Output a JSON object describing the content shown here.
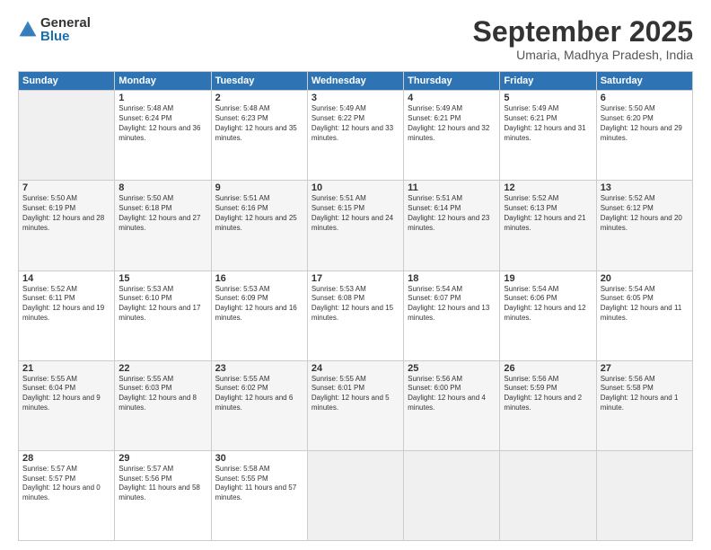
{
  "logo": {
    "general": "General",
    "blue": "Blue"
  },
  "title": "September 2025",
  "subtitle": "Umaria, Madhya Pradesh, India",
  "weekdays": [
    "Sunday",
    "Monday",
    "Tuesday",
    "Wednesday",
    "Thursday",
    "Friday",
    "Saturday"
  ],
  "weeks": [
    [
      {
        "day": "",
        "empty": true
      },
      {
        "day": "1",
        "sunrise": "5:48 AM",
        "sunset": "6:24 PM",
        "daylight": "12 hours and 36 minutes."
      },
      {
        "day": "2",
        "sunrise": "5:48 AM",
        "sunset": "6:23 PM",
        "daylight": "12 hours and 35 minutes."
      },
      {
        "day": "3",
        "sunrise": "5:49 AM",
        "sunset": "6:22 PM",
        "daylight": "12 hours and 33 minutes."
      },
      {
        "day": "4",
        "sunrise": "5:49 AM",
        "sunset": "6:21 PM",
        "daylight": "12 hours and 32 minutes."
      },
      {
        "day": "5",
        "sunrise": "5:49 AM",
        "sunset": "6:21 PM",
        "daylight": "12 hours and 31 minutes."
      },
      {
        "day": "6",
        "sunrise": "5:50 AM",
        "sunset": "6:20 PM",
        "daylight": "12 hours and 29 minutes."
      }
    ],
    [
      {
        "day": "7",
        "sunrise": "5:50 AM",
        "sunset": "6:19 PM",
        "daylight": "12 hours and 28 minutes."
      },
      {
        "day": "8",
        "sunrise": "5:50 AM",
        "sunset": "6:18 PM",
        "daylight": "12 hours and 27 minutes."
      },
      {
        "day": "9",
        "sunrise": "5:51 AM",
        "sunset": "6:16 PM",
        "daylight": "12 hours and 25 minutes."
      },
      {
        "day": "10",
        "sunrise": "5:51 AM",
        "sunset": "6:15 PM",
        "daylight": "12 hours and 24 minutes."
      },
      {
        "day": "11",
        "sunrise": "5:51 AM",
        "sunset": "6:14 PM",
        "daylight": "12 hours and 23 minutes."
      },
      {
        "day": "12",
        "sunrise": "5:52 AM",
        "sunset": "6:13 PM",
        "daylight": "12 hours and 21 minutes."
      },
      {
        "day": "13",
        "sunrise": "5:52 AM",
        "sunset": "6:12 PM",
        "daylight": "12 hours and 20 minutes."
      }
    ],
    [
      {
        "day": "14",
        "sunrise": "5:52 AM",
        "sunset": "6:11 PM",
        "daylight": "12 hours and 19 minutes."
      },
      {
        "day": "15",
        "sunrise": "5:53 AM",
        "sunset": "6:10 PM",
        "daylight": "12 hours and 17 minutes."
      },
      {
        "day": "16",
        "sunrise": "5:53 AM",
        "sunset": "6:09 PM",
        "daylight": "12 hours and 16 minutes."
      },
      {
        "day": "17",
        "sunrise": "5:53 AM",
        "sunset": "6:08 PM",
        "daylight": "12 hours and 15 minutes."
      },
      {
        "day": "18",
        "sunrise": "5:54 AM",
        "sunset": "6:07 PM",
        "daylight": "12 hours and 13 minutes."
      },
      {
        "day": "19",
        "sunrise": "5:54 AM",
        "sunset": "6:06 PM",
        "daylight": "12 hours and 12 minutes."
      },
      {
        "day": "20",
        "sunrise": "5:54 AM",
        "sunset": "6:05 PM",
        "daylight": "12 hours and 11 minutes."
      }
    ],
    [
      {
        "day": "21",
        "sunrise": "5:55 AM",
        "sunset": "6:04 PM",
        "daylight": "12 hours and 9 minutes."
      },
      {
        "day": "22",
        "sunrise": "5:55 AM",
        "sunset": "6:03 PM",
        "daylight": "12 hours and 8 minutes."
      },
      {
        "day": "23",
        "sunrise": "5:55 AM",
        "sunset": "6:02 PM",
        "daylight": "12 hours and 6 minutes."
      },
      {
        "day": "24",
        "sunrise": "5:55 AM",
        "sunset": "6:01 PM",
        "daylight": "12 hours and 5 minutes."
      },
      {
        "day": "25",
        "sunrise": "5:56 AM",
        "sunset": "6:00 PM",
        "daylight": "12 hours and 4 minutes."
      },
      {
        "day": "26",
        "sunrise": "5:56 AM",
        "sunset": "5:59 PM",
        "daylight": "12 hours and 2 minutes."
      },
      {
        "day": "27",
        "sunrise": "5:56 AM",
        "sunset": "5:58 PM",
        "daylight": "12 hours and 1 minute."
      }
    ],
    [
      {
        "day": "28",
        "sunrise": "5:57 AM",
        "sunset": "5:57 PM",
        "daylight": "12 hours and 0 minutes."
      },
      {
        "day": "29",
        "sunrise": "5:57 AM",
        "sunset": "5:56 PM",
        "daylight": "11 hours and 58 minutes."
      },
      {
        "day": "30",
        "sunrise": "5:58 AM",
        "sunset": "5:55 PM",
        "daylight": "11 hours and 57 minutes."
      },
      {
        "day": "",
        "empty": true
      },
      {
        "day": "",
        "empty": true
      },
      {
        "day": "",
        "empty": true
      },
      {
        "day": "",
        "empty": true
      }
    ]
  ]
}
